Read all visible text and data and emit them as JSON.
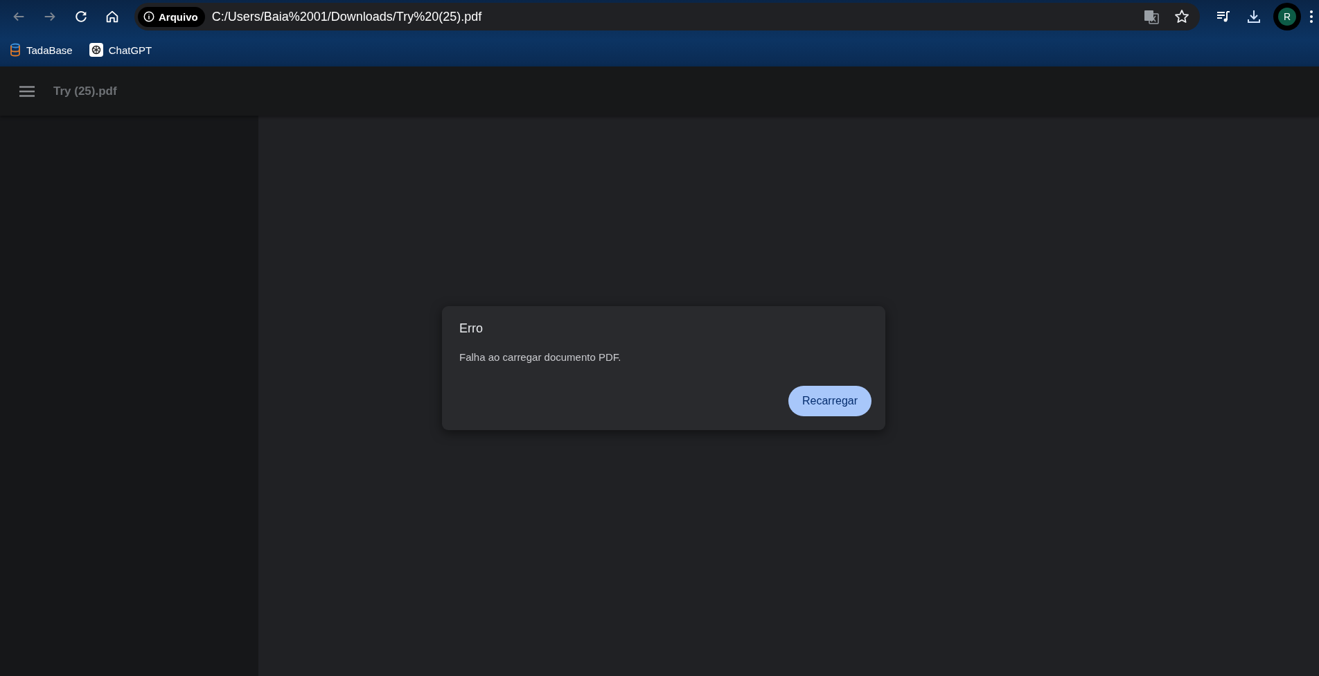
{
  "browser": {
    "nav": [
      {
        "kind": "back",
        "disabled": true
      },
      {
        "kind": "forward",
        "disabled": true
      },
      {
        "kind": "reload",
        "disabled": false
      },
      {
        "kind": "home",
        "disabled": false
      }
    ],
    "address": {
      "chip": "Arquivo",
      "url": "C:/Users/Baia%2001/Downloads/Try%20(25).pdf"
    },
    "profile_initial": "R",
    "bookmarks": [
      {
        "label": "TadaBase"
      },
      {
        "label": "ChatGPT"
      }
    ]
  },
  "viewer": {
    "title": "Try (25).pdf"
  },
  "dialog": {
    "title": "Erro",
    "message": "Falha ao carregar documento PDF.",
    "button": "Recarregar"
  }
}
